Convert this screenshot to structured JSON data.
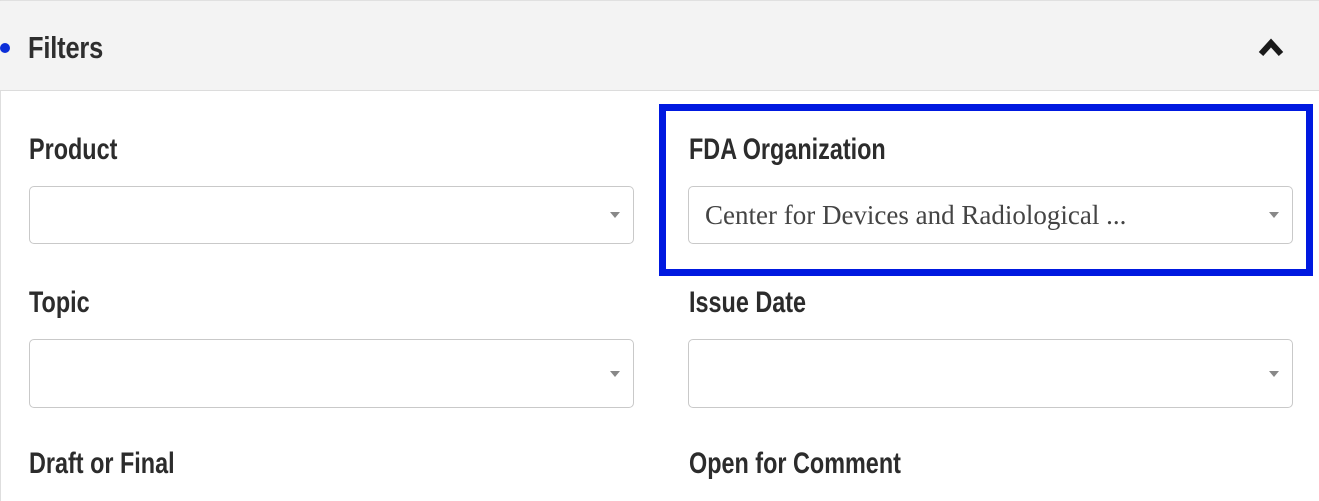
{
  "filters": {
    "title": "Filters",
    "collapse_icon": "chevron-up-icon",
    "fields": {
      "product": {
        "label": "Product",
        "value": ""
      },
      "fda_organization": {
        "label": "FDA Organization",
        "value": "Center for Devices and Radiological ..."
      },
      "topic": {
        "label": "Topic",
        "value": ""
      },
      "issue_date": {
        "label": "Issue Date",
        "value": ""
      },
      "draft_or_final": {
        "label": "Draft or Final"
      },
      "open_for_comment": {
        "label": "Open for Comment"
      }
    },
    "dropdown_icon": "caret-down-icon"
  },
  "colors": {
    "header_background": "#f3f3f3",
    "label_text": "#2c2c2c",
    "highlight": "#0019e0",
    "focus_dot": "#0b2ed8"
  }
}
